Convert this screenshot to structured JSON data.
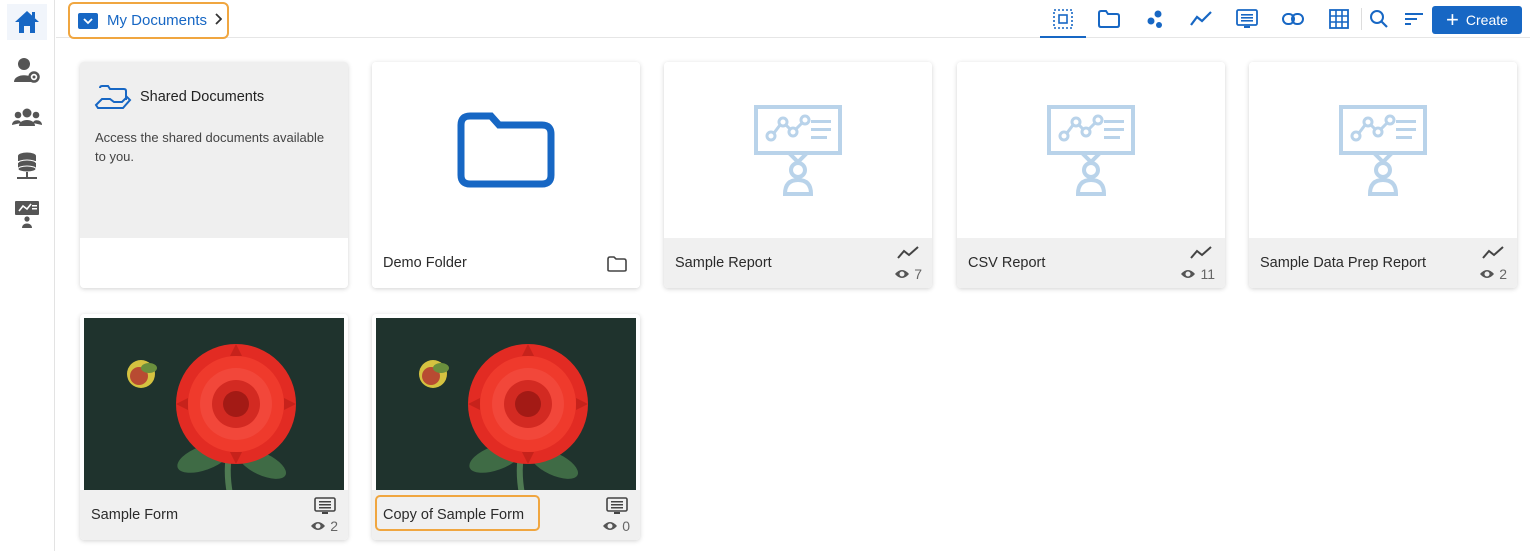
{
  "breadcrumb": {
    "label": "My Documents"
  },
  "toolbar": {
    "create_label": "Create"
  },
  "colors": {
    "accent": "#1767c4",
    "highlight": "#f0a640",
    "icon_light": "#b9d3ea"
  },
  "sidebar": {
    "items": [
      {
        "icon": "home-icon"
      },
      {
        "icon": "user-settings-icon"
      },
      {
        "icon": "users-group-icon"
      },
      {
        "icon": "database-icon"
      },
      {
        "icon": "presentation-icon"
      }
    ]
  },
  "cards": {
    "shared": {
      "title": "Shared Documents",
      "description": "Access the shared documents available to you."
    },
    "demo_folder": {
      "title": "Demo Folder"
    },
    "sample_report": {
      "title": "Sample Report",
      "views": "7"
    },
    "csv_report": {
      "title": "CSV Report",
      "views": "11"
    },
    "data_prep_report": {
      "title": "Sample Data Prep Report",
      "views": "2"
    },
    "sample_form": {
      "title": "Sample Form",
      "views": "2"
    },
    "copy_sample_form": {
      "title": "Copy of Sample Form",
      "views": "0"
    }
  }
}
